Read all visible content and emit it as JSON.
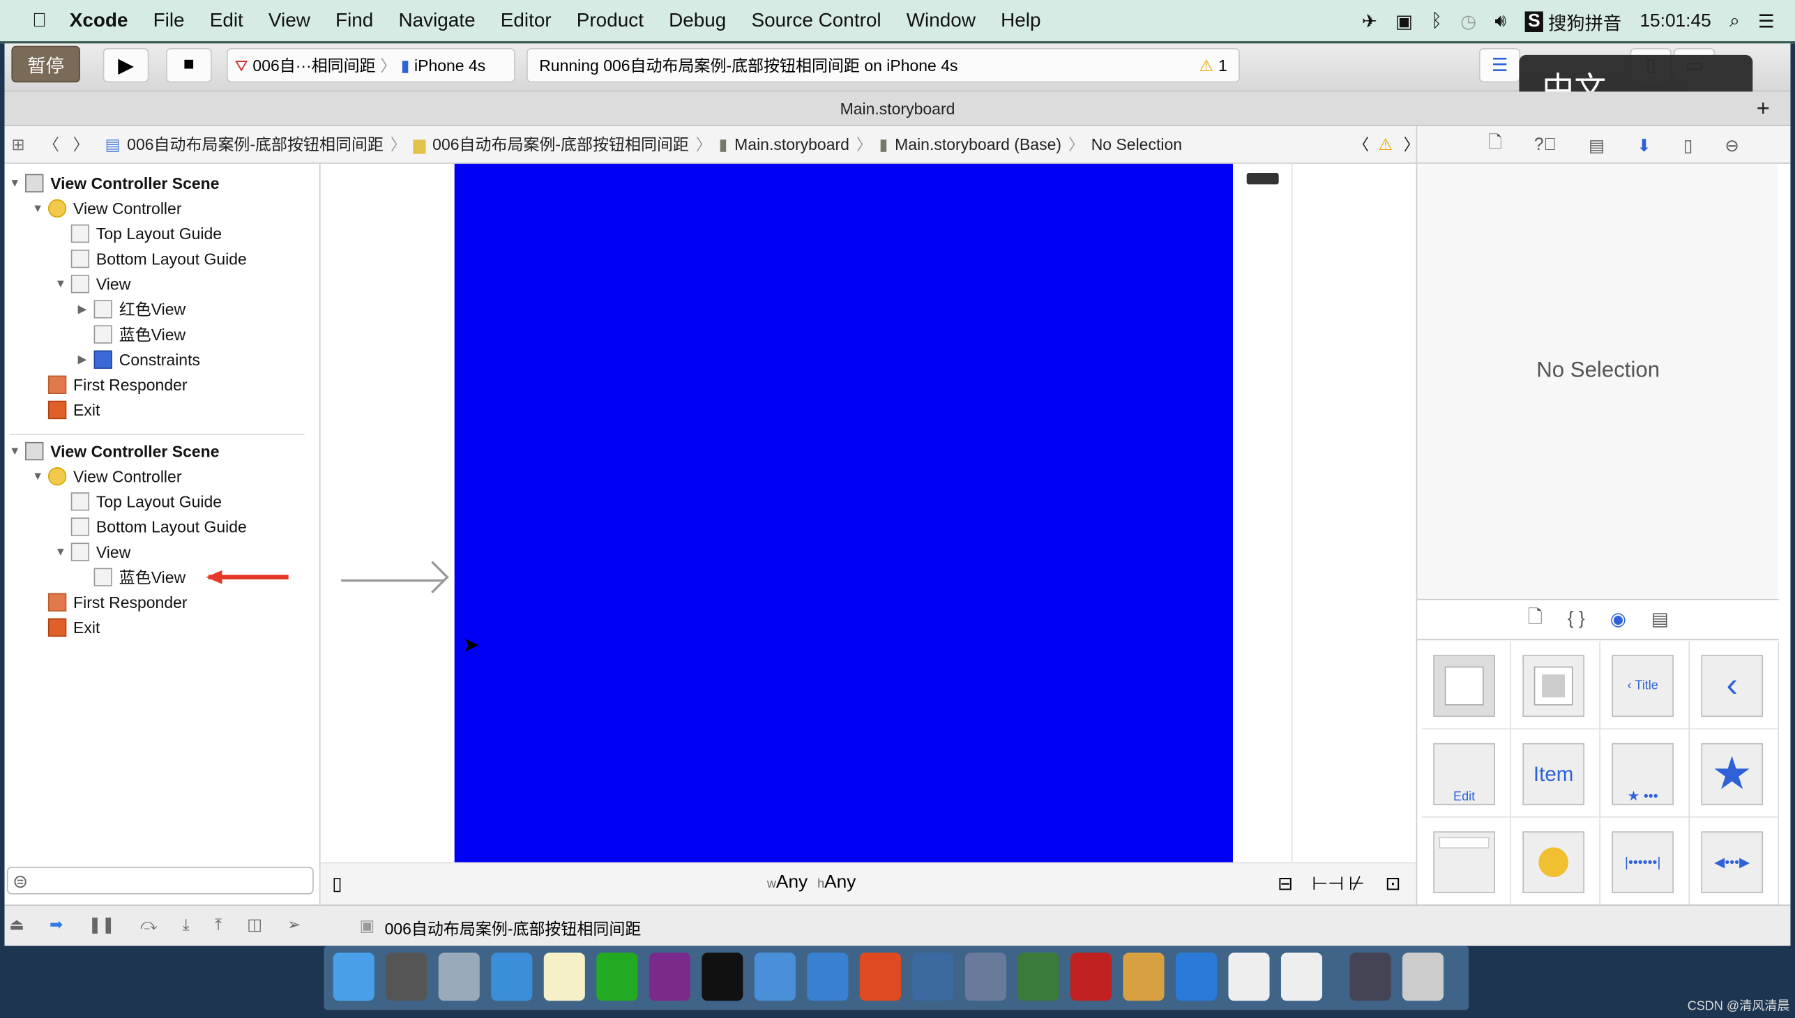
{
  "menubar": {
    "app": "Xcode",
    "items": [
      "File",
      "Edit",
      "View",
      "Find",
      "Navigate",
      "Editor",
      "Product",
      "Debug",
      "Source Control",
      "Window",
      "Help"
    ],
    "input_method": "搜狗拼音",
    "time": "15:01:45"
  },
  "toolbar": {
    "pause_label": "暂停",
    "scheme": "006自···相同间距",
    "device": "iPhone 4s",
    "status": "Running 006自动布局案例-底部按钮相同间距 on iPhone 4s",
    "warning_count": "1",
    "ime_overlay": "中文"
  },
  "tab": {
    "title": "Main.storyboard"
  },
  "jumpbar": {
    "items": [
      "006自动布局案例-底部按钮相同间距",
      "006自动布局案例-底部按钮相同间距",
      "Main.storyboard",
      "Main.storyboard (Base)",
      "No Selection"
    ]
  },
  "outline": [
    {
      "label": "View Controller Scene",
      "level": 0,
      "toggle": "open",
      "icon": "scene",
      "bold": true
    },
    {
      "label": "View Controller",
      "level": 1,
      "toggle": "open",
      "icon": "vc"
    },
    {
      "label": "Top Layout Guide",
      "level": 2,
      "icon": "view"
    },
    {
      "label": "Bottom Layout Guide",
      "level": 2,
      "icon": "view"
    },
    {
      "label": "View",
      "level": 2,
      "toggle": "open",
      "icon": "view"
    },
    {
      "label": "红色View",
      "level": 3,
      "toggle": "closed",
      "icon": "view"
    },
    {
      "label": "蓝色View",
      "level": 3,
      "icon": "view"
    },
    {
      "label": "Constraints",
      "level": 3,
      "toggle": "closed",
      "icon": "constraints"
    },
    {
      "label": "First Responder",
      "level": 1,
      "icon": "responder"
    },
    {
      "label": "Exit",
      "level": 1,
      "icon": "exit"
    },
    {
      "label": "View Controller Scene",
      "level": 0,
      "toggle": "open",
      "icon": "scene",
      "bold": true
    },
    {
      "label": "View Controller",
      "level": 1,
      "toggle": "open",
      "icon": "vc"
    },
    {
      "label": "Top Layout Guide",
      "level": 2,
      "icon": "view"
    },
    {
      "label": "Bottom Layout Guide",
      "level": 2,
      "icon": "view"
    },
    {
      "label": "View",
      "level": 2,
      "toggle": "open",
      "icon": "view"
    },
    {
      "label": "蓝色View",
      "level": 3,
      "icon": "view"
    },
    {
      "label": "First Responder",
      "level": 1,
      "icon": "responder"
    },
    {
      "label": "Exit",
      "level": 1,
      "icon": "exit"
    }
  ],
  "canvas": {
    "view_color": "#0000f5",
    "size_class_w": "Any",
    "size_class_h": "Any",
    "w_prefix": "w",
    "h_prefix": "h"
  },
  "inspector": {
    "empty_label": "No Selection"
  },
  "library": {
    "items": [
      "View",
      "Container View",
      "Title",
      "Back",
      "Edit",
      "Item",
      "Toolbar",
      "Star",
      "Search Bar",
      "Search Display",
      "Fixed Space",
      "Flexible Space"
    ],
    "labels": {
      "title": "Title",
      "edit": "Edit",
      "item": "Item"
    }
  },
  "debugbar": {
    "target": "006自动布局案例-底部按钮相同间距"
  },
  "watermark": "CSDN @清风清晨",
  "colors": {
    "accent": "#2f62d8",
    "annotation_arrow": "#e53a2a"
  }
}
